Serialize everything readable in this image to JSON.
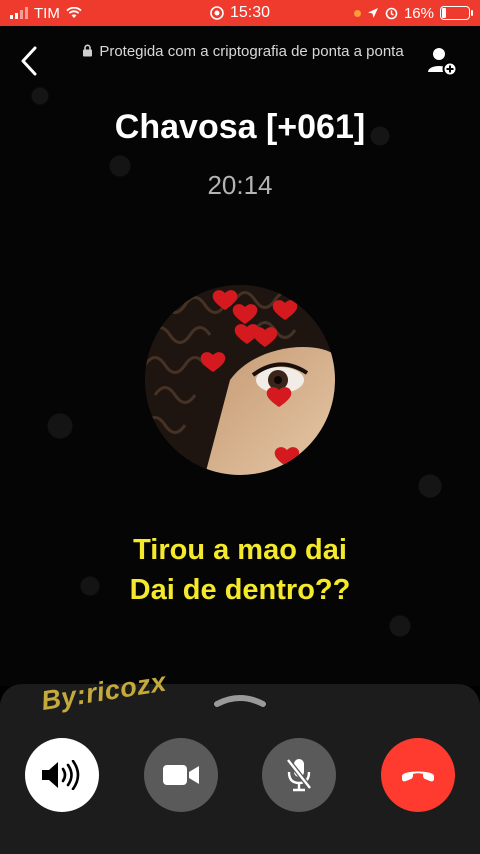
{
  "status_bar": {
    "carrier": "TIM",
    "time": "15:30",
    "battery": "16%",
    "battery_level": 0.16,
    "background_color": "#ef3b2e"
  },
  "header": {
    "back_icon": "chevron-left-icon",
    "encryption_text": "Protegida com a criptografia de ponta a ponta",
    "lock_icon": "lock-icon",
    "add_participant_icon": "add-person-icon"
  },
  "contact": {
    "name": "Chavosa [+061]",
    "call_duration": "20:14"
  },
  "overlay": {
    "caption_line_1": "Tirou a mao dai",
    "caption_line_2": "Dai de dentro??",
    "caption_color": "#f4ea2b",
    "watermark": "By:ricozx"
  },
  "controls": {
    "speaker_icon": "speaker-icon",
    "video_icon": "video-camera-icon",
    "mute_icon": "microphone-off-icon",
    "end_call_icon": "phone-hangup-icon",
    "end_call_color": "#ff3b30"
  }
}
